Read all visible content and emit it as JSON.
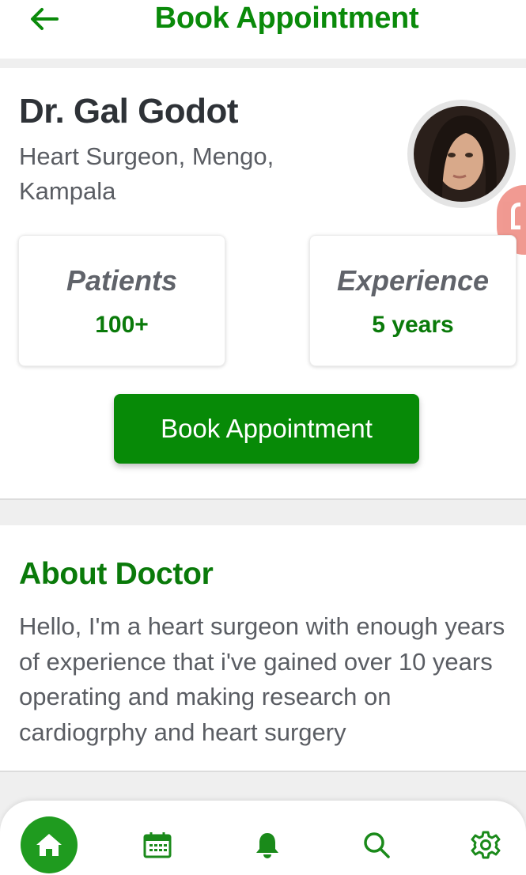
{
  "header": {
    "title": "Book Appointment",
    "back_icon": "arrow-left-icon",
    "accent_color": "#0a8a0a"
  },
  "doctor": {
    "name": "Dr. Gal Godot",
    "specialty": "Heart Surgeon, Mengo, Kampala"
  },
  "stats": {
    "patients_label": "Patients",
    "patients_value": "100+",
    "experience_label": "Experience",
    "experience_value": "5 years"
  },
  "book_button": {
    "label": "Book Appointment",
    "color": "#078a07"
  },
  "about": {
    "title": "About Doctor",
    "text": "Hello, I'm a heart surgeon with enough years of experience that i've gained over 10 years operating and making research on cardiogrphy and heart surgery"
  },
  "bottom_nav": {
    "items": [
      {
        "icon": "home-icon",
        "active": true
      },
      {
        "icon": "calendar-icon",
        "active": false
      },
      {
        "icon": "bell-icon",
        "active": false
      },
      {
        "icon": "search-icon",
        "active": false
      },
      {
        "icon": "gear-icon",
        "active": false
      }
    ]
  }
}
